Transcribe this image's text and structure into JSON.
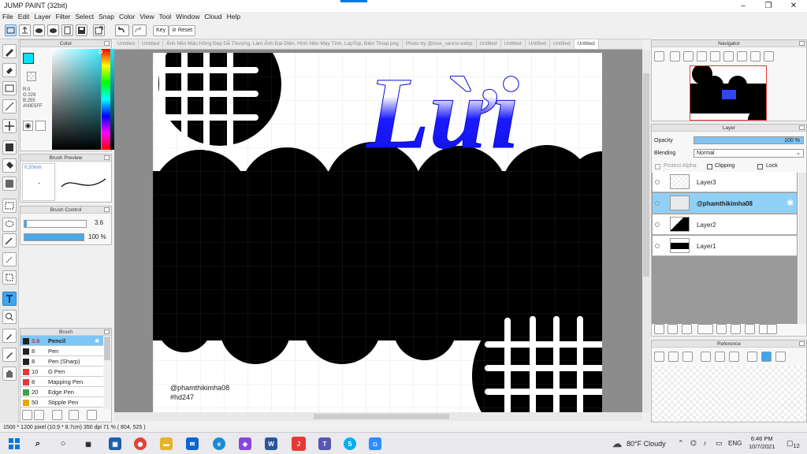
{
  "window": {
    "title": "JUMP PAINT (32bit)"
  },
  "menu": [
    "File",
    "Edit",
    "Layer",
    "Filter",
    "Select",
    "Snap",
    "Color",
    "View",
    "Tool",
    "Window",
    "Cloud",
    "Help"
  ],
  "toolbar": {
    "key_label": "Key",
    "reset_label": "Reset"
  },
  "tabs": [
    "Untitled",
    "Untitled",
    "Ảnh Nền Màu Hồng Đẹp Dễ Thương, Làm Ảnh Đại Diện, Hình Nền Máy Tính, LapTop, Điện Thoại.png",
    "Photo by @love_sanrio.webp",
    "Untitled",
    "Untitled",
    "Untitled",
    "Untitled",
    "Untitled"
  ],
  "color_panel": {
    "title": "Color",
    "r": "R:0",
    "g": "G:229",
    "b": "B:255",
    "hex": "#00E5FF",
    "accent": "#00E5FF"
  },
  "brush_preview": {
    "title": "Brush Preview",
    "size": "0.20mm"
  },
  "brush_control": {
    "title": "Brush Control",
    "size_value": "3.6",
    "opacity_value": "100 %"
  },
  "brush_list": {
    "title": "Brush",
    "items": [
      {
        "size": "3.6",
        "name": "Pencil",
        "color": "#222222",
        "selected": true
      },
      {
        "size": "8",
        "name": "Pen",
        "color": "#222222"
      },
      {
        "size": "8",
        "name": "Pen (Sharp)",
        "color": "#222222"
      },
      {
        "size": "10",
        "name": "G Pen",
        "color": "#e53935"
      },
      {
        "size": "8",
        "name": "Mapping Pen",
        "color": "#e53935"
      },
      {
        "size": "20",
        "name": "Edge Pen",
        "color": "#43a047"
      },
      {
        "size": "50",
        "name": "Stipple Pen",
        "color": "#e6a800"
      }
    ]
  },
  "canvas": {
    "art_text": "Lừi",
    "watermark_user": "@phamthikimha08",
    "watermark_tag": "#hd247"
  },
  "navigator": {
    "title": "Navigator"
  },
  "layer_panel": {
    "title": "Layer",
    "opacity_label": "Opacity",
    "opacity_value": "100 %",
    "blending_label": "Blending",
    "blending_value": "Normal",
    "protect_alpha": "Protect Alpha",
    "clipping": "Clipping",
    "lock": "Lock",
    "layers": [
      {
        "name": "Layer3"
      },
      {
        "name": "@phamthikimha08",
        "selected": true
      },
      {
        "name": "Layer2"
      },
      {
        "name": "Layer1"
      }
    ]
  },
  "reference": {
    "title": "Reference"
  },
  "status": {
    "text": "1500 * 1200 pixel   (10.9 * 8.7cm)   350 dpi   71 %   ( 804, 525 )"
  },
  "taskbar": {
    "weather": "80°F  Cloudy",
    "lang": "ENG",
    "time": "6:46 PM",
    "date": "10/7/2021",
    "notif": "12"
  }
}
